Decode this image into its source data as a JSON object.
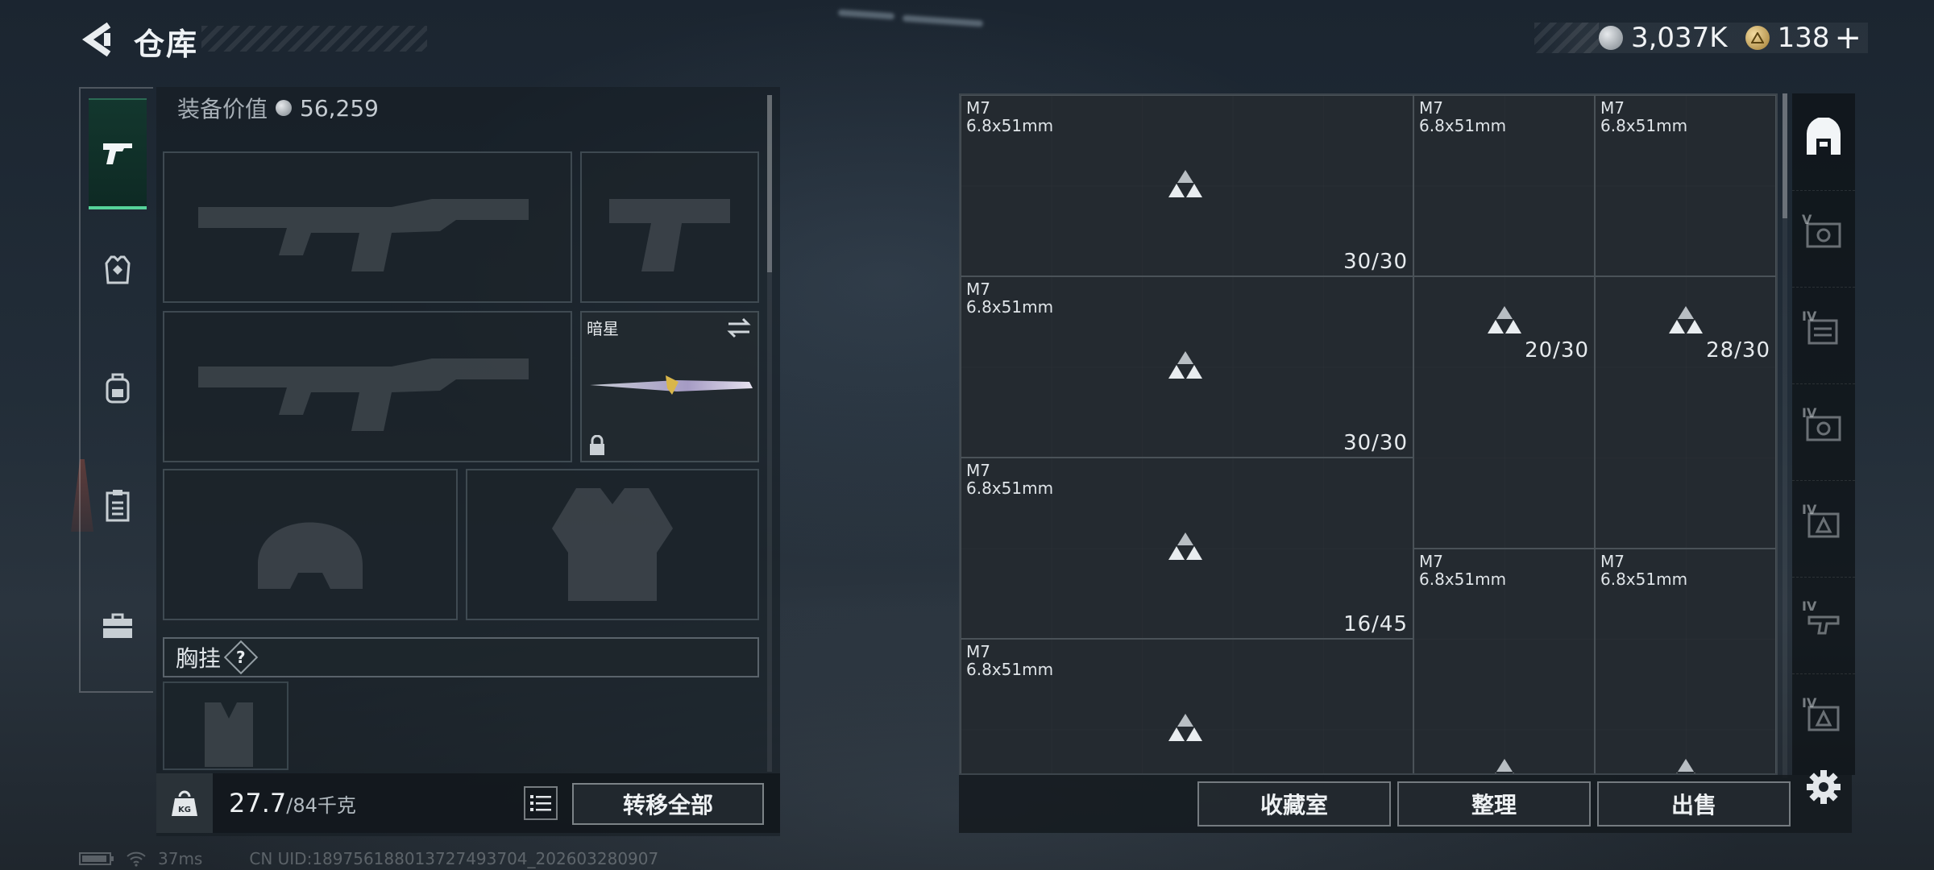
{
  "header": {
    "title": "仓库"
  },
  "currency": [
    {
      "icon": "silver-coin-icon",
      "value": "3,037K"
    },
    {
      "icon": "gold-coin-icon",
      "value": "138"
    }
  ],
  "add_label": "+",
  "left_nav": [
    {
      "name": "weapon",
      "icon": "pistol-icon",
      "active": true
    },
    {
      "name": "armor",
      "icon": "vest-icon",
      "active": false
    },
    {
      "name": "backpack",
      "icon": "backpack-icon",
      "active": false
    },
    {
      "name": "tasks",
      "icon": "clipboard-icon",
      "active": false
    },
    {
      "name": "toolbox",
      "icon": "briefcase-icon",
      "active": false
    }
  ],
  "equipment": {
    "value_label": "装备价值",
    "value": "56,259",
    "melee_name": "暗星",
    "chest_label": "胸挂",
    "help": "?",
    "weight_current": "27.7",
    "weight_max": "/84千克",
    "transfer_all": "转移全部"
  },
  "storage_items": [
    {
      "name": "M7",
      "caliber": "6.8x51mm",
      "count": "30/30"
    },
    {
      "name": "M7",
      "caliber": "6.8x51mm",
      "count": ""
    },
    {
      "name": "M7",
      "caliber": "6.8x51mm",
      "count": "20/30"
    },
    {
      "name": "M7",
      "caliber": "6.8x51mm",
      "count": ""
    },
    {
      "name": "M7",
      "caliber": "6.8x51mm",
      "count": "28/30"
    },
    {
      "name": "M7",
      "caliber": "6.8x51mm",
      "count": "30/30"
    },
    {
      "name": "M7",
      "caliber": "6.8x51mm",
      "count": "16/45"
    },
    {
      "name": "M7",
      "caliber": "6.8x51mm",
      "count": ""
    },
    {
      "name": "M7",
      "caliber": "6.8x51mm",
      "count": ""
    },
    {
      "name": "M7",
      "caliber": "6.8x51mm",
      "count": ""
    }
  ],
  "actions": {
    "collection": "收藏室",
    "sort": "整理",
    "sell": "出售"
  },
  "right_nav_tags": [
    "",
    "V",
    "IV",
    "IV",
    "IV",
    "IV",
    "IV"
  ],
  "status": {
    "ping": "37ms",
    "uid": "CN UID:1897561880137274937​04_202603280907"
  },
  "colors": {
    "accent": "#56d39a",
    "panel": "#1b2024"
  }
}
